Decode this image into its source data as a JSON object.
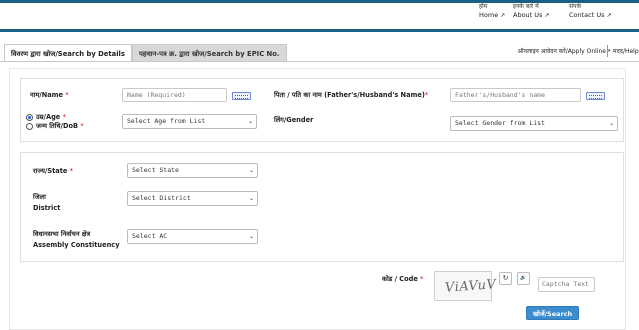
{
  "nav": {
    "home_hi": "होम",
    "home_en": "Home",
    "about_hi": "इनके बारे में",
    "about_en": "About Us",
    "contact_hi": "संपर्क",
    "contact_en": "Contact Us",
    "external_icon": "↗"
  },
  "tabs": [
    {
      "label": "विवरण द्वारा खोज/Search by Details",
      "active": true
    },
    {
      "label": "पहचान-पत्र क्र. द्वारा खोज/Search by EPIC No.",
      "active": false
    }
  ],
  "apply_online": "ऑनलाइन आवेदन करें/Apply Online",
  "help": "मदद/Help",
  "form": {
    "name_label": "नाम/Name",
    "name_placeholder": "Name (Required)",
    "relative_label": "पिता / पति का नाम (Father's/Husband's Name)",
    "relative_placeholder": "Father's/Husband's name",
    "age_label": "उम्र/Age",
    "dob_label": "जन्म तिथि/DoB",
    "age_select": "Select Age from List",
    "gender_label": "लिंग/Gender",
    "gender_select": "Select Gender from List",
    "state_label": "राज्य/State",
    "state_select": "Select State",
    "district_label_hi": "जिला",
    "district_label_en": "District",
    "district_select": "Select District",
    "ac_label_hi": "विधानसभा निर्वाचन क्षेत्र",
    "ac_label_en": "Assembly Constituency",
    "ac_select": "Select AC",
    "code_label": "कोड / Code",
    "captcha_text": "ViAVuV",
    "captcha_placeholder": "Captcha Text",
    "refresh_icon": "↻",
    "audio_icon": "🔊",
    "search_button": "खोजें/Search",
    "required_mark": "*"
  }
}
